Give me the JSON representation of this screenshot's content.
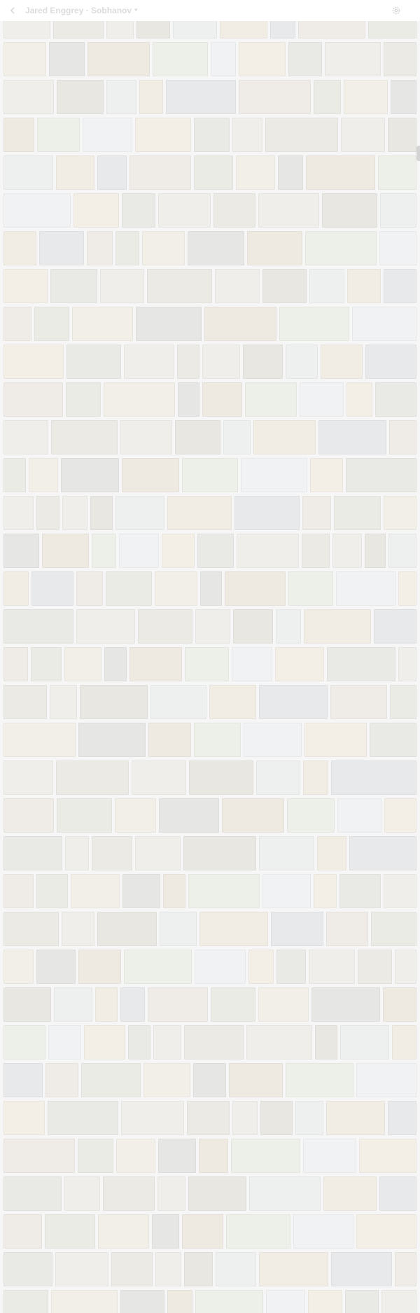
{
  "header": {
    "title": "Jared Enggrey · Sobhanov",
    "caret": "▾",
    "back_icon": "back-arrow-icon",
    "settings_icon": "gear-icon"
  },
  "gallery": {
    "tile_palette": [
      "#efeeea",
      "#eceae5",
      "#f0eeea",
      "#e9e7e2",
      "#edf0ee",
      "#f1ede5",
      "#e8e9ea",
      "#efece7",
      "#ebebe6",
      "#f2efe9",
      "#e6e6e4",
      "#eeeae2",
      "#edf0e9",
      "#f0f2f4",
      "#f3eee6",
      "#e9eae6"
    ]
  }
}
